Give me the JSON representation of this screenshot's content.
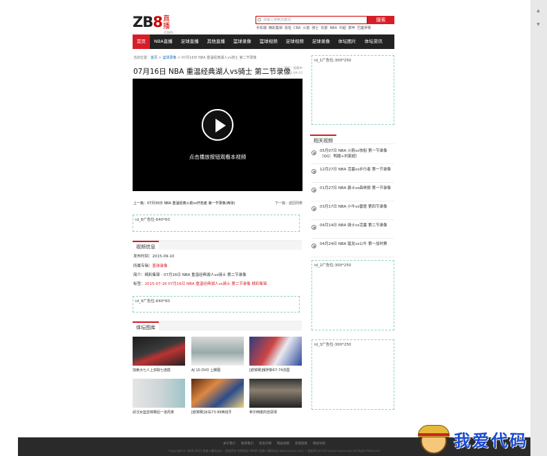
{
  "logo": {
    "text_main": "ZB",
    "text_red": "8",
    "cn": "直播",
    "dot": ".com"
  },
  "search": {
    "placeholder": "请输入搜索关键词",
    "button": "搜索"
  },
  "hot_keywords": [
    "手机端",
    "精彩集锦",
    "恩佐",
    "CBA",
    "火箭",
    "骑士",
    "东部",
    "NBA",
    "中超",
    "意甲",
    "巴塞罗那"
  ],
  "nav": [
    "首页",
    "NBA直播",
    "足球直播",
    "其他直播",
    "篮球录像",
    "篮球视频",
    "足球视频",
    "足球录像",
    "体坛图片",
    "体坛资讯"
  ],
  "breadcrumb": {
    "prefix": "当前位置：",
    "home": "首页",
    "sep1": " > ",
    "cat": "篮球录像",
    "sep2": " > ",
    "current": "07月16日 NBA 重温经典湖人vs骑士 第二节录像"
  },
  "article": {
    "title": "07月16日 NBA 重温经典湖人vs骑士 第二节录像",
    "meta_views": "浏览：加载中",
    "meta_date": "2015-09-10"
  },
  "video": {
    "tip": "点击播放按钮观看本视频"
  },
  "prevnext": {
    "prev": "上一篇：07月30日 NBA 重温经典火箭vs开拓者 第一节录像(两张)",
    "next": "下一篇：返回列表"
  },
  "ads": {
    "id8": "id_8广告位-640*60",
    "id9": "id_9广告位-640*60",
    "id1": "id_1广告位-300*250",
    "id2": "id_2广告位-300*250",
    "id3": "id_3广告位-300*250"
  },
  "video_info": {
    "heading": "视频信息",
    "publish": "发布时间：2015-09-10",
    "category_label": "所属专辑：",
    "category": "篮球录像",
    "summary": "简介：精彩集锦 - 07月16日 NBA 重温经典湖人vs骑士 第二节录像",
    "tags_label": "标签：",
    "tags": "2015-07-16 07月16日 NBA 重温经典湖人vs骑士 第二节录像 精彩集锦"
  },
  "gallery": {
    "heading": "体坛图库",
    "items": [
      "加索大七人上双取七连胜",
      "AJ 10 OVO 上脚图",
      "[欧锦赛]俄罗斯67-74法国",
      "武汉女篮亚锦赛后一道风景",
      "[欧锦赛]冰岛73-99西班牙",
      "希尔两度的自惩球"
    ]
  },
  "related": {
    "heading": "相关视频",
    "items": [
      {
        "l1": "05月07日 NBA 火箭vs快船 第一节录像",
        "l2": "（QQ：鸭腿+刘家超）"
      },
      {
        "l1": "12月27日 NBA 活塞vs步行者 第一节录像",
        "l2": ""
      },
      {
        "l1": "01月27日 NBA 爵士vs森林狼 第一节录像",
        "l2": ""
      },
      {
        "l1": "03月17日 NBA 小牛vs雷霆 第四节录像",
        "l2": ""
      },
      {
        "l1": "04月14日 NBA 骑士vs活塞 第二节录像",
        "l2": ""
      },
      {
        "l1": "04月24日 NBA 猛龙vs公牛 第一加时赛",
        "l2": ""
      }
    ]
  },
  "footer": {
    "links": [
      "关于我们",
      "联系我们",
      "免责声明",
      "网站地图",
      "友情链接",
      "网站导航"
    ],
    "copy": "Copyright © 2008-2015 直播人播网站站 一直推荐你 免费版权 00000 直播人播网站站 (www.xxxxx.com) 一直推荐Call 123-xxxxx-xxxxx.com All Rights Reserved"
  },
  "watermark": {
    "text": "我爱代码"
  },
  "colors": {
    "brand_red": "#d71d27",
    "nav_bg": "#222222",
    "ad_border": "#8ccfc8",
    "footer_bg": "#2a2a2a"
  }
}
